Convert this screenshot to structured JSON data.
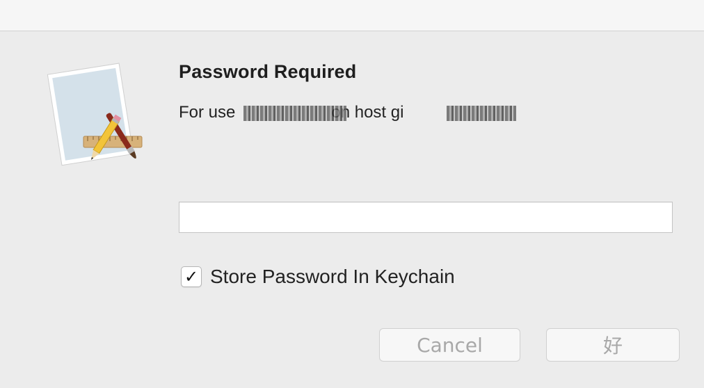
{
  "dialog": {
    "title": "Password Required",
    "message_prefix": "For use",
    "message_middle": "on host gi"
  },
  "password_field": {
    "value": "",
    "placeholder": ""
  },
  "store_in_keychain": {
    "checked": true,
    "check_mark": "✓",
    "label": "Store Password In Keychain"
  },
  "buttons": {
    "cancel_label": "Cancel",
    "ok_label": "好"
  },
  "icons": {
    "app_icon": "xcode-pencil-brush-ruler-icon"
  },
  "colors": {
    "background": "#ececec",
    "titlebar": "#f6f6f6",
    "button_text_disabled": "#a8a8a8"
  }
}
